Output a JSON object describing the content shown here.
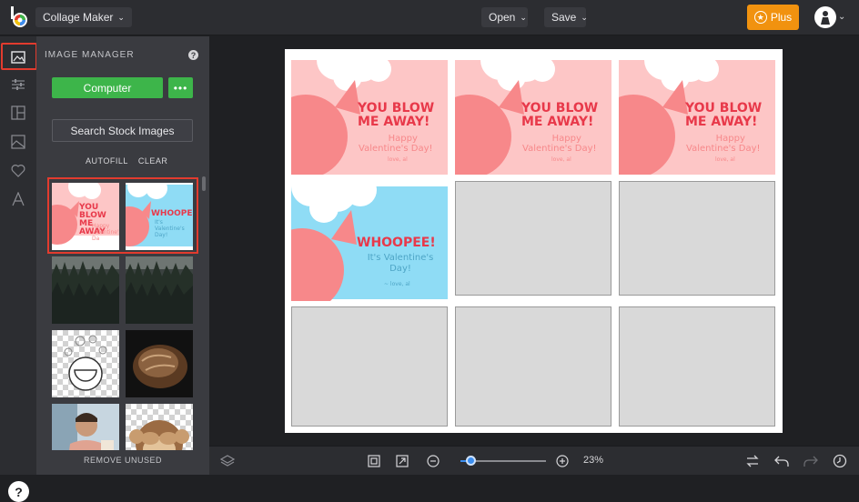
{
  "app": {
    "title": "Collage Maker"
  },
  "topbar": {
    "open_label": "Open",
    "save_label": "Save",
    "plus_label": "Plus"
  },
  "panel": {
    "title": "IMAGE MANAGER",
    "computer_label": "Computer",
    "more_label": "•••",
    "stock_label": "Search Stock Images",
    "autofill_label": "AUTOFILL",
    "clear_label": "CLEAR",
    "remove_unused_label": "REMOVE UNUSED",
    "thumbs": [
      {
        "kind": "valentine-pink",
        "heading": "YOU BLOW ME AWAY!",
        "line": "Happy Valentine's Day!",
        "sign": "love, al"
      },
      {
        "kind": "valentine-blue",
        "heading": "WHOOPEE!",
        "line": "It's Valentine's Day!",
        "sign": "love, al"
      },
      {
        "kind": "forest"
      },
      {
        "kind": "forest"
      },
      {
        "kind": "watermelon-drawing"
      },
      {
        "kind": "bread"
      },
      {
        "kind": "man-smiling"
      },
      {
        "kind": "monkey-emoji"
      }
    ]
  },
  "help_label": "?",
  "canvas": {
    "cards": [
      {
        "heading1": "YOU BLOW",
        "heading2": "ME AWAY!",
        "line1": "Happy",
        "line2": "Valentine's Day!",
        "sign": "love, al"
      },
      {
        "heading1": "YOU BLOW",
        "heading2": "ME AWAY!",
        "line1": "Happy",
        "line2": "Valentine's Day!",
        "sign": "love, al"
      },
      {
        "heading1": "YOU BLOW",
        "heading2": "ME AWAY!",
        "line1": "Happy",
        "line2": "Valentine's Day!",
        "sign": "love, al"
      },
      {
        "heading1": "WHOOPEE!",
        "line1": "It's Valentine's",
        "line2": "Day!",
        "sign": "~ love, al"
      }
    ]
  },
  "bottombar": {
    "zoom_label": "23%",
    "zoom_fraction": 0.12
  },
  "colors": {
    "accent_orange": "#f1920f",
    "green": "#3db54a",
    "selection_red": "#e23b2e",
    "valentine_pink": "#fdc6c6",
    "balloon": "#f7888a",
    "valentine_blue": "#8fdcf5",
    "heading_red": "#e8394a"
  }
}
